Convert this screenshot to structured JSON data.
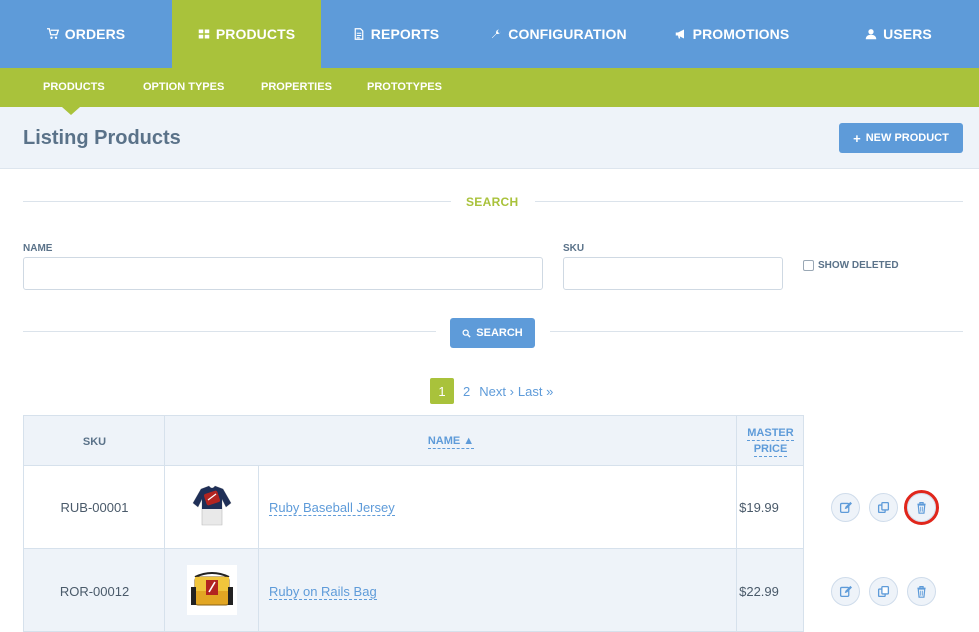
{
  "topnav": {
    "items": [
      {
        "label": "ORDERS",
        "icon": "cart-icon",
        "active": false
      },
      {
        "label": "PRODUCTS",
        "icon": "grid-icon",
        "active": true
      },
      {
        "label": "REPORTS",
        "icon": "file-icon",
        "active": false
      },
      {
        "label": "CONFIGURATION",
        "icon": "wrench-icon",
        "active": false
      },
      {
        "label": "PROMOTIONS",
        "icon": "megaphone-icon",
        "active": false
      },
      {
        "label": "USERS",
        "icon": "user-icon",
        "active": false
      }
    ]
  },
  "subnav": {
    "items": [
      {
        "label": "PRODUCTS"
      },
      {
        "label": "OPTION TYPES"
      },
      {
        "label": "PROPERTIES"
      },
      {
        "label": "PROTOTYPES"
      }
    ]
  },
  "header": {
    "title": "Listing Products",
    "new_button": "NEW PRODUCT"
  },
  "search": {
    "title": "SEARCH",
    "name_label": "NAME",
    "name_value": "",
    "sku_label": "SKU",
    "sku_value": "",
    "show_deleted_label": "SHOW DELETED",
    "button": "SEARCH"
  },
  "pagination": {
    "current": "1",
    "page2": "2",
    "next": "Next ›",
    "last": "Last »"
  },
  "table": {
    "headers": {
      "sku": "SKU",
      "name": "NAME ▲",
      "price_line1": "MASTER",
      "price_line2": "PRICE"
    },
    "rows": [
      {
        "sku": "RUB-00001",
        "name": "Ruby Baseball Jersey",
        "price": "$19.99"
      },
      {
        "sku": "ROR-00012",
        "name": "Ruby on Rails Bag",
        "price": "$22.99"
      }
    ]
  },
  "colors": {
    "primary": "#5e9bd9",
    "accent": "#a9c23b",
    "highlight": "#e0261b"
  }
}
